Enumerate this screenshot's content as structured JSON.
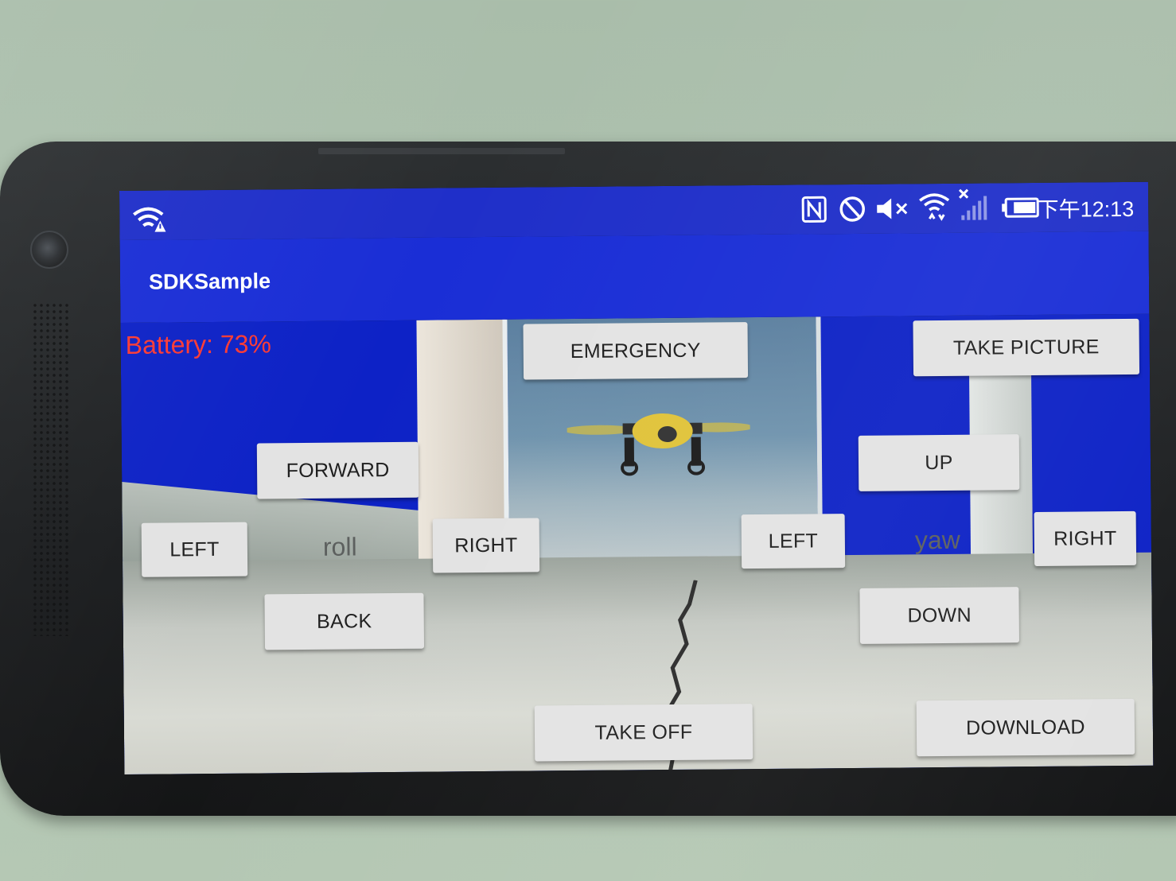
{
  "status_bar": {
    "time": "下午12:13",
    "icons": [
      "wifi-warning-icon",
      "nfc-icon",
      "do-not-disturb-icon",
      "mute-icon",
      "wifi-icon",
      "signal-off-icon",
      "battery-icon"
    ]
  },
  "app": {
    "title": "SDKSample",
    "theme_color": "#1a2ed6",
    "status_color": "#1f2fc9"
  },
  "telemetry": {
    "battery_text": "Battery: 73%",
    "battery_color": "#ff3a32"
  },
  "controls": {
    "emergency": "EMERGENCY",
    "take_picture": "TAKE PICTURE",
    "forward": "FORWARD",
    "back": "BACK",
    "roll_left": "LEFT",
    "roll_right": "RIGHT",
    "roll_label": "roll",
    "up": "UP",
    "down": "DOWN",
    "yaw_left": "LEFT",
    "yaw_right": "RIGHT",
    "yaw_label": "yaw",
    "take_off": "TAKE OFF",
    "download": "DOWNLOAD"
  }
}
